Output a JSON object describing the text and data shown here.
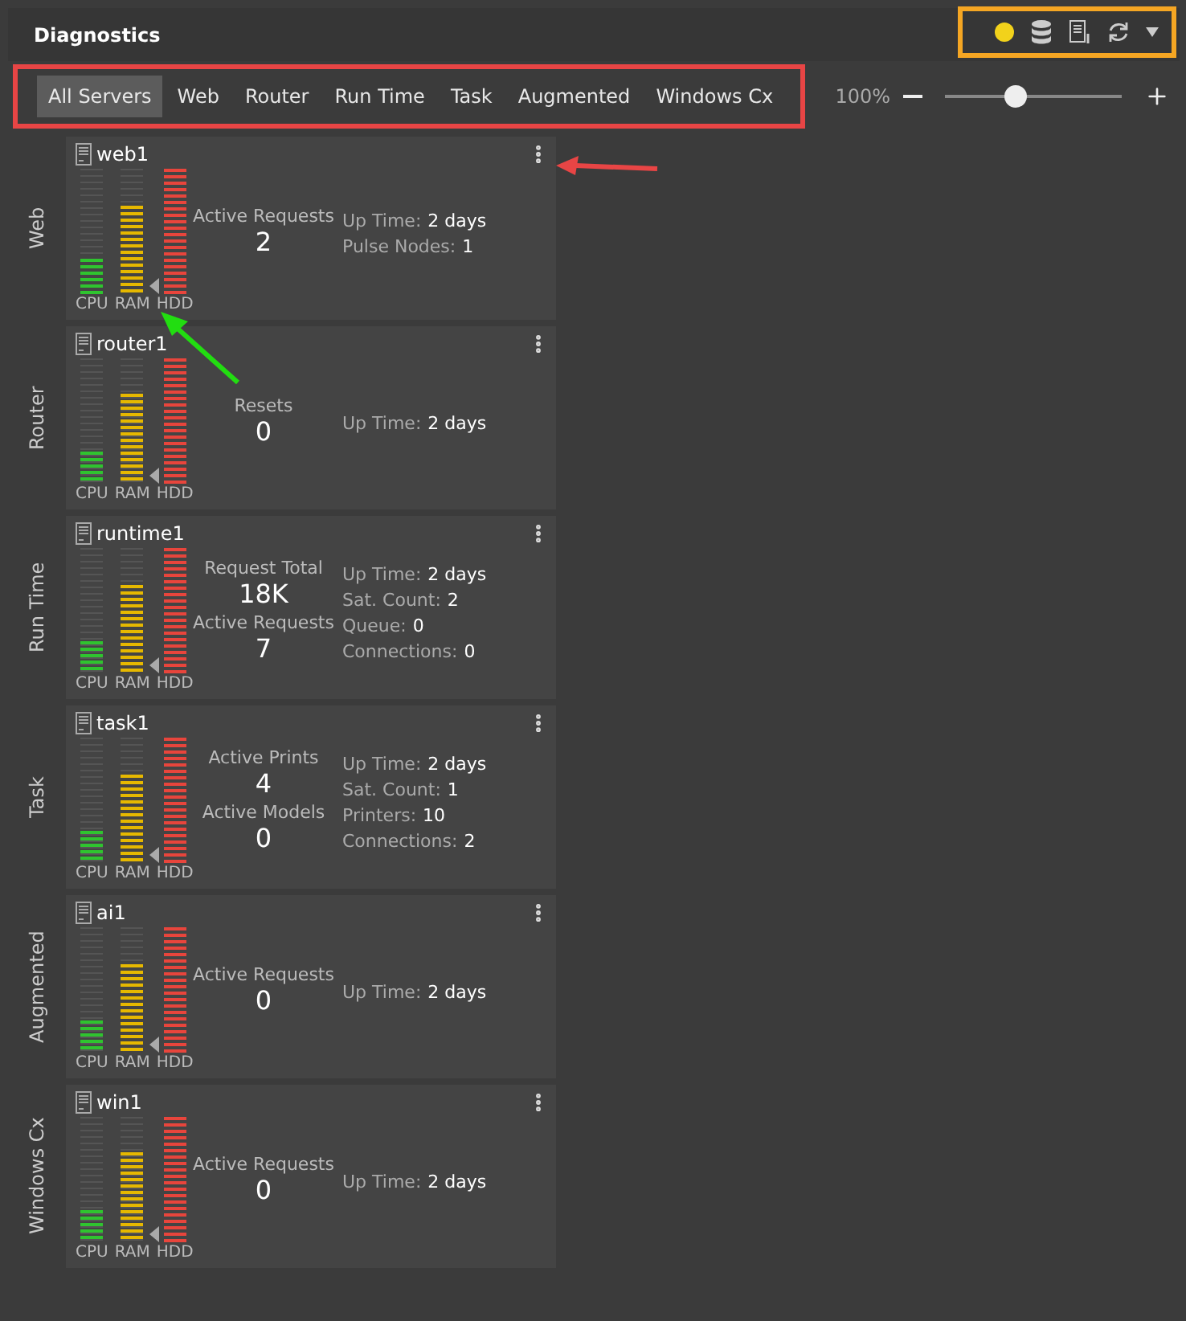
{
  "window": {
    "title": "Diagnostics"
  },
  "status_dot": {
    "color": "#f2d21b"
  },
  "tabs": [
    {
      "label": "All Servers",
      "selected": true
    },
    {
      "label": "Web",
      "selected": false
    },
    {
      "label": "Router",
      "selected": false
    },
    {
      "label": "Run Time",
      "selected": false
    },
    {
      "label": "Task",
      "selected": false
    },
    {
      "label": "Augmented",
      "selected": false
    },
    {
      "label": "Windows Cx",
      "selected": false
    }
  ],
  "zoom": {
    "reading": "100%",
    "level": 0.4
  },
  "servers": [
    {
      "group": "Web",
      "name": "web1",
      "meters": [
        {
          "label": "CPU",
          "level": 0.28
        },
        {
          "label": "RAM",
          "level": 0.7
        },
        {
          "label": "HDD",
          "level": 1
        }
      ],
      "stats": [
        {
          "label": "Active Requests",
          "value": "2"
        }
      ],
      "details": [
        {
          "label": "Up Time:",
          "value": "2 days"
        },
        {
          "label": "Pulse Nodes:",
          "value": "1"
        }
      ]
    },
    {
      "group": "Router",
      "name": "router1",
      "meters": [
        {
          "label": "CPU",
          "level": 0.26
        },
        {
          "label": "RAM",
          "level": 0.72
        },
        {
          "label": "HDD",
          "level": 1
        }
      ],
      "stats": [
        {
          "label": "Resets",
          "value": "0"
        }
      ],
      "details": [
        {
          "label": "Up Time:",
          "value": "2 days"
        }
      ]
    },
    {
      "group": "Run Time",
      "name": "runtime1",
      "meters": [
        {
          "label": "CPU",
          "level": 0.26
        },
        {
          "label": "RAM",
          "level": 0.7
        },
        {
          "label": "HDD",
          "level": 1
        }
      ],
      "stats": [
        {
          "label": "Request Total",
          "value": "18K"
        },
        {
          "label": "Active Requests",
          "value": "7"
        }
      ],
      "details": [
        {
          "label": "Up Time:",
          "value": "2 days"
        },
        {
          "label": "Sat. Count:",
          "value": "2"
        },
        {
          "label": "Queue:",
          "value": "0"
        },
        {
          "label": "Connections:",
          "value": "0"
        }
      ]
    },
    {
      "group": "Task",
      "name": "task1",
      "meters": [
        {
          "label": "CPU",
          "level": 0.26
        },
        {
          "label": "RAM",
          "level": 0.7
        },
        {
          "label": "HDD",
          "level": 1
        }
      ],
      "stats": [
        {
          "label": "Active Prints",
          "value": "4"
        },
        {
          "label": "Active Models",
          "value": "0"
        }
      ],
      "details": [
        {
          "label": "Up Time:",
          "value": "2 days"
        },
        {
          "label": "Sat. Count:",
          "value": "1"
        },
        {
          "label": "Printers:",
          "value": "10"
        },
        {
          "label": "Connections:",
          "value": "2"
        }
      ]
    },
    {
      "group": "Augmented",
      "name": "ai1",
      "meters": [
        {
          "label": "CPU",
          "level": 0.26
        },
        {
          "label": "RAM",
          "level": 0.7
        },
        {
          "label": "HDD",
          "level": 1
        }
      ],
      "stats": [
        {
          "label": "Active Requests",
          "value": "0"
        }
      ],
      "details": [
        {
          "label": "Up Time:",
          "value": "2 days"
        }
      ]
    },
    {
      "group": "Windows Cx",
      "name": "win1",
      "meters": [
        {
          "label": "CPU",
          "level": 0.26
        },
        {
          "label": "RAM",
          "level": 0.72
        },
        {
          "label": "HDD",
          "level": 1
        }
      ],
      "stats": [
        {
          "label": "Active Requests",
          "value": "0"
        }
      ],
      "details": [
        {
          "label": "Up Time:",
          "value": "2 days"
        }
      ]
    }
  ],
  "callouts": [
    {
      "kind": "menu",
      "color": "#e84545"
    },
    {
      "kind": "meter",
      "color": "#22dd11"
    }
  ]
}
